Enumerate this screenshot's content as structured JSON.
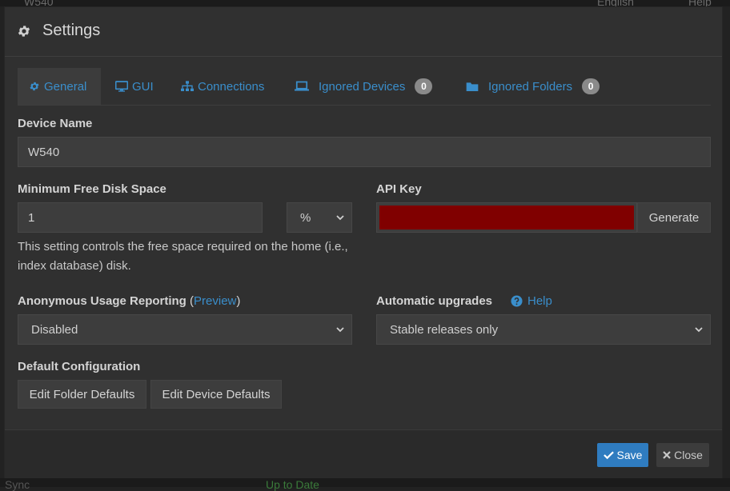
{
  "background": {
    "top_left_text": "W540",
    "top_language": "English",
    "top_help": "Help",
    "bottom_left_text": "Sync",
    "bottom_status": "Up to Date"
  },
  "modal": {
    "title": "Settings",
    "icon": "gear-icon"
  },
  "tabs": [
    {
      "label": "General",
      "icon": "gear-icon",
      "active": true
    },
    {
      "label": "GUI",
      "icon": "monitor-icon"
    },
    {
      "label": "Connections",
      "icon": "sitemap-icon"
    },
    {
      "label": "Ignored Devices",
      "icon": "laptop-icon",
      "badge": "0"
    },
    {
      "label": "Ignored Folders",
      "icon": "folder-icon",
      "badge": "0"
    }
  ],
  "general": {
    "device_name": {
      "label": "Device Name",
      "value": "W540"
    },
    "min_disk": {
      "label": "Minimum Free Disk Space",
      "value": "1",
      "unit": "%",
      "help": "This setting controls the free space required on the home (i.e., index database) disk."
    },
    "api_key": {
      "label": "API Key",
      "field_color": "#800000",
      "generate_label": "Generate"
    },
    "usage": {
      "label": "Anonymous Usage Reporting",
      "paren_open": "(",
      "preview_link": "Preview",
      "paren_close": ")",
      "value": "Disabled"
    },
    "upgrades": {
      "label": "Automatic upgrades",
      "help_link": "Help",
      "value": "Stable releases only"
    },
    "default_config": {
      "label": "Default Configuration",
      "edit_folder": "Edit Folder Defaults",
      "edit_device": "Edit Device Defaults"
    }
  },
  "footer": {
    "save_label": "Save",
    "close_label": "Close"
  },
  "colors": {
    "accent": "#3a8ecb",
    "save_button": "#2f7cc0",
    "api_key_redacted": "#800000"
  }
}
